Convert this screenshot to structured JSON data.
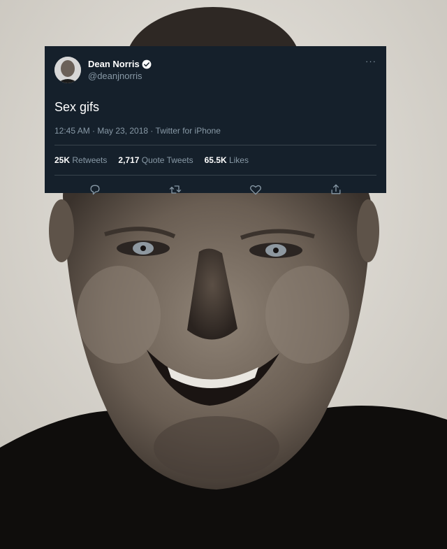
{
  "tweet": {
    "display_name": "Dean Norris",
    "handle": "@deanjnorris",
    "more_label": "···",
    "text": "Sex gifs",
    "meta": "12:45 AM · May 23, 2018 · Twitter for iPhone",
    "stats": [
      {
        "value": "25K",
        "label": "Retweets"
      },
      {
        "value": "2,717",
        "label": "Quote Tweets"
      },
      {
        "value": "65.5K",
        "label": "Likes"
      }
    ],
    "icons": {
      "verified": "verified-badge-icon",
      "reply": "reply-icon",
      "retweet": "retweet-icon",
      "like": "heart-icon",
      "share": "share-icon",
      "more": "more-dots-icon"
    },
    "colors": {
      "card_bg": "#15202b",
      "secondary_text": "#8899a6",
      "verified": "#1da1f2",
      "divider": "#38444d"
    }
  }
}
